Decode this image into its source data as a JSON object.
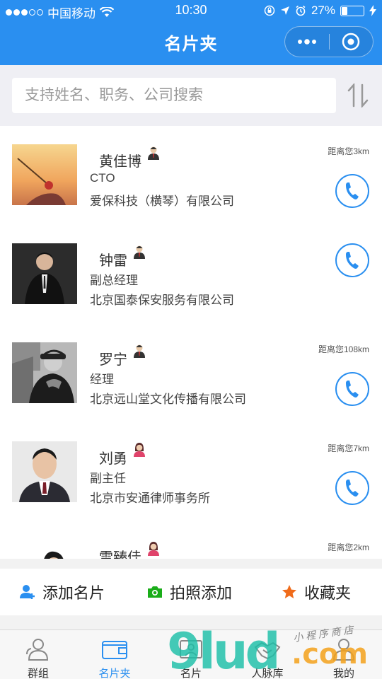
{
  "status_bar": {
    "carrier": "中国移动",
    "time": "10:30",
    "battery": "27%",
    "battery_level": 0.27
  },
  "nav": {
    "title": "名片夹"
  },
  "search": {
    "placeholder": "支持姓名、职务、公司搜索"
  },
  "contacts": [
    {
      "name": "黄佳博",
      "title": "CTO",
      "company": "爱保科技（横琴）有限公司",
      "distance": "距离您3km",
      "badge": "male"
    },
    {
      "name": "钟雷",
      "title": "副总经理",
      "company": "北京国泰保安服务有限公司",
      "distance": "",
      "badge": "male"
    },
    {
      "name": "罗宁",
      "title": "经理",
      "company": "北京远山堂文化传播有限公司",
      "distance": "距离您108km",
      "badge": "male"
    },
    {
      "name": "刘勇",
      "title": "副主任",
      "company": "北京市安通律师事务所",
      "distance": "距离您7km",
      "badge": "female"
    },
    {
      "name": "雷臻佳",
      "title": "",
      "company": "",
      "distance": "距离您2km",
      "badge": "female"
    }
  ],
  "actions": {
    "add_card": "添加名片",
    "photo_add": "拍照添加",
    "favorites": "收藏夹"
  },
  "tabs": [
    {
      "label": "群组",
      "icon": "group-icon"
    },
    {
      "label": "名片夹",
      "icon": "wallet-icon",
      "active": true
    },
    {
      "label": "名片",
      "icon": "card-icon"
    },
    {
      "label": "人脉库",
      "icon": "handshake-icon"
    },
    {
      "label": "我的",
      "icon": "person-icon"
    }
  ],
  "watermark": {
    "text": "9lud",
    "domain": ".com",
    "caption": "小 程 序 商 店"
  },
  "colors": {
    "primary": "#2a8ff0",
    "add_icon": "#2a8ff0",
    "camera_icon": "#1aad19",
    "star_icon": "#f06b1a"
  }
}
